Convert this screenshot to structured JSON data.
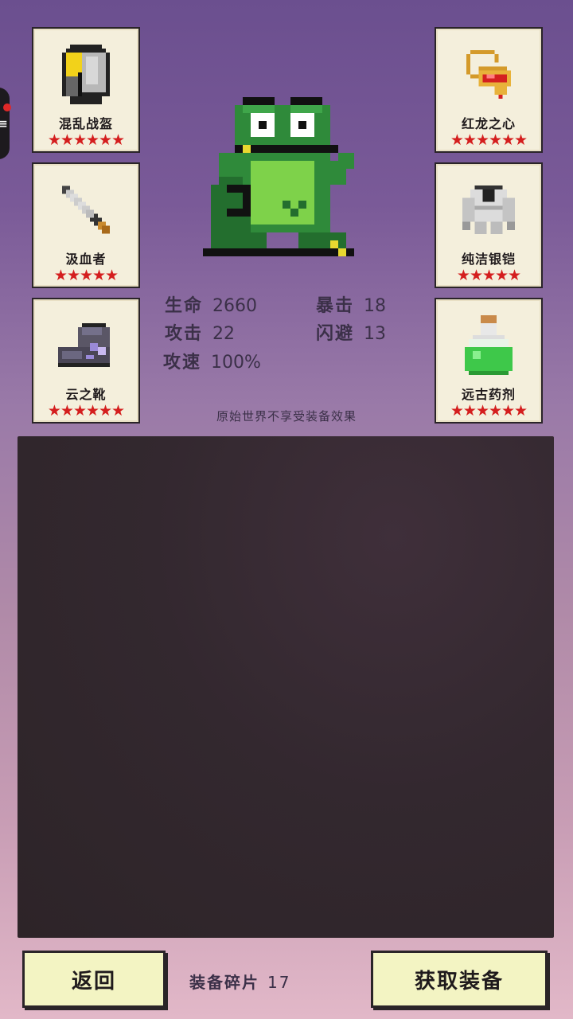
{
  "equipment": {
    "left": [
      {
        "name": "混乱战盔",
        "icon": "helmet-icon",
        "stars": "★★★★★★"
      },
      {
        "name": "汲血者",
        "icon": "dagger-icon",
        "stars": "★★★★★"
      },
      {
        "name": "云之靴",
        "icon": "boots-icon",
        "stars": "★★★★★★"
      }
    ],
    "right": [
      {
        "name": "红龙之心",
        "icon": "amulet-icon",
        "stars": "★★★★★★"
      },
      {
        "name": "纯洁银铠",
        "icon": "armor-icon",
        "stars": "★★★★★"
      },
      {
        "name": "远古药剂",
        "icon": "potion-icon",
        "stars": "★★★★★★"
      }
    ]
  },
  "stats": {
    "hp_label": "生命",
    "hp": "2660",
    "crit_label": "暴击",
    "crit": "18",
    "atk_label": "攻击",
    "atk": "22",
    "dodge_label": "闪避",
    "dodge": "13",
    "speed_label": "攻速",
    "speed": "100%"
  },
  "note": "原始世界不享受装备效果",
  "footer": {
    "back_label": "返回",
    "shards_label": "装备碎片",
    "shards_value": "17",
    "get_label": "获取装备"
  },
  "colors": {
    "star": "#d41e1e",
    "button_bg": "#f3f4c3",
    "panel_bg": "#33282f"
  }
}
